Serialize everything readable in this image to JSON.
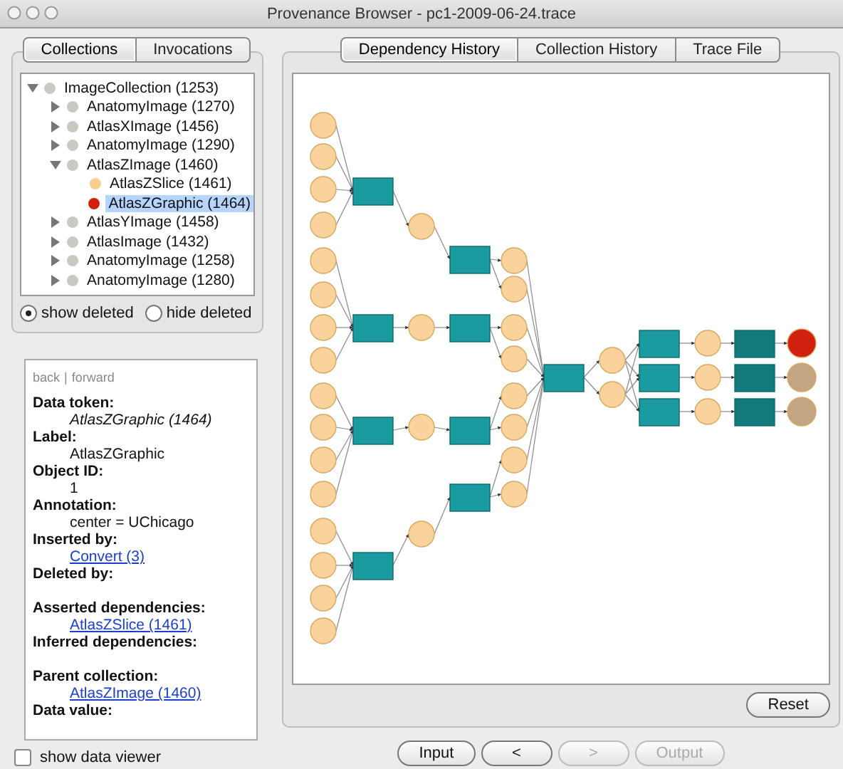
{
  "window": {
    "title": "Provenance Browser - pc1-2009-06-24.trace"
  },
  "left_tabs": [
    {
      "label": "Collections",
      "selected": true
    },
    {
      "label": "Invocations",
      "selected": false
    }
  ],
  "tree": [
    {
      "label": "ImageCollection (1253)",
      "color": "#c9c9c2",
      "expanded": true,
      "selected": false,
      "children": [
        {
          "label": "AnatomyImage (1270)",
          "color": "#c9c9c2",
          "expanded": false,
          "selected": false
        },
        {
          "label": "AtlasXImage (1456)",
          "color": "#c9c9c2",
          "expanded": false,
          "selected": false
        },
        {
          "label": "AnatomyImage (1290)",
          "color": "#c9c9c2",
          "expanded": false,
          "selected": false
        },
        {
          "label": "AtlasZImage (1460)",
          "color": "#c9c9c2",
          "expanded": true,
          "selected": false,
          "children": [
            {
              "label": "AtlasZSlice (1461)",
              "color": "#f6cf8f",
              "selected": false
            },
            {
              "label": "AtlasZGraphic (1464)",
              "color": "#d2200f",
              "selected": true
            }
          ]
        },
        {
          "label": "AtlasYImage (1458)",
          "color": "#c9c9c2",
          "expanded": false,
          "selected": false
        },
        {
          "label": "AtlasImage (1432)",
          "color": "#c9c9c2",
          "expanded": false,
          "selected": false
        },
        {
          "label": "AnatomyImage (1258)",
          "color": "#c9c9c2",
          "expanded": false,
          "selected": false
        },
        {
          "label": "AnatomyImage (1280)",
          "color": "#c9c9c2",
          "expanded": false,
          "selected": false
        }
      ]
    }
  ],
  "deleted_filter": [
    {
      "label": "show deleted",
      "selected": true
    },
    {
      "label": "hide deleted",
      "selected": false
    }
  ],
  "nav": {
    "back": "back",
    "separator": "|",
    "forward": "forward"
  },
  "details": [
    {
      "label": "Data token:",
      "value": "AtlasZGraphic (1464)",
      "kind": "italic"
    },
    {
      "label": "Label:",
      "value": "AtlasZGraphic",
      "kind": "plain"
    },
    {
      "label": "Object ID:",
      "value": "1",
      "kind": "plain"
    },
    {
      "label": "Annotation:",
      "value": "center = UChicago",
      "kind": "plain"
    },
    {
      "label": "Inserted by:",
      "value": "Convert (3)",
      "kind": "link"
    },
    {
      "label": "Deleted by:",
      "kind": "empty"
    },
    {
      "label": "Asserted dependencies:",
      "value": "AtlasZSlice (1461)",
      "kind": "link"
    },
    {
      "label": "Inferred dependencies:",
      "kind": "empty"
    },
    {
      "label": "Parent collection:",
      "value": "AtlasZImage (1460)",
      "kind": "link"
    },
    {
      "label": "Data value:",
      "kind": "plain"
    }
  ],
  "show_data_viewer": {
    "label": "show data viewer",
    "checked": false
  },
  "right_tabs": [
    {
      "label": "Dependency History",
      "selected": true
    },
    {
      "label": "Collection History",
      "selected": false
    },
    {
      "label": "Trace File",
      "selected": false
    }
  ],
  "reset_button": "Reset",
  "nav_buttons": [
    {
      "label": "Input",
      "disabled": false
    },
    {
      "label": "<",
      "disabled": false
    },
    {
      "label": ">",
      "disabled": true
    },
    {
      "label": "Output",
      "disabled": true
    }
  ]
}
